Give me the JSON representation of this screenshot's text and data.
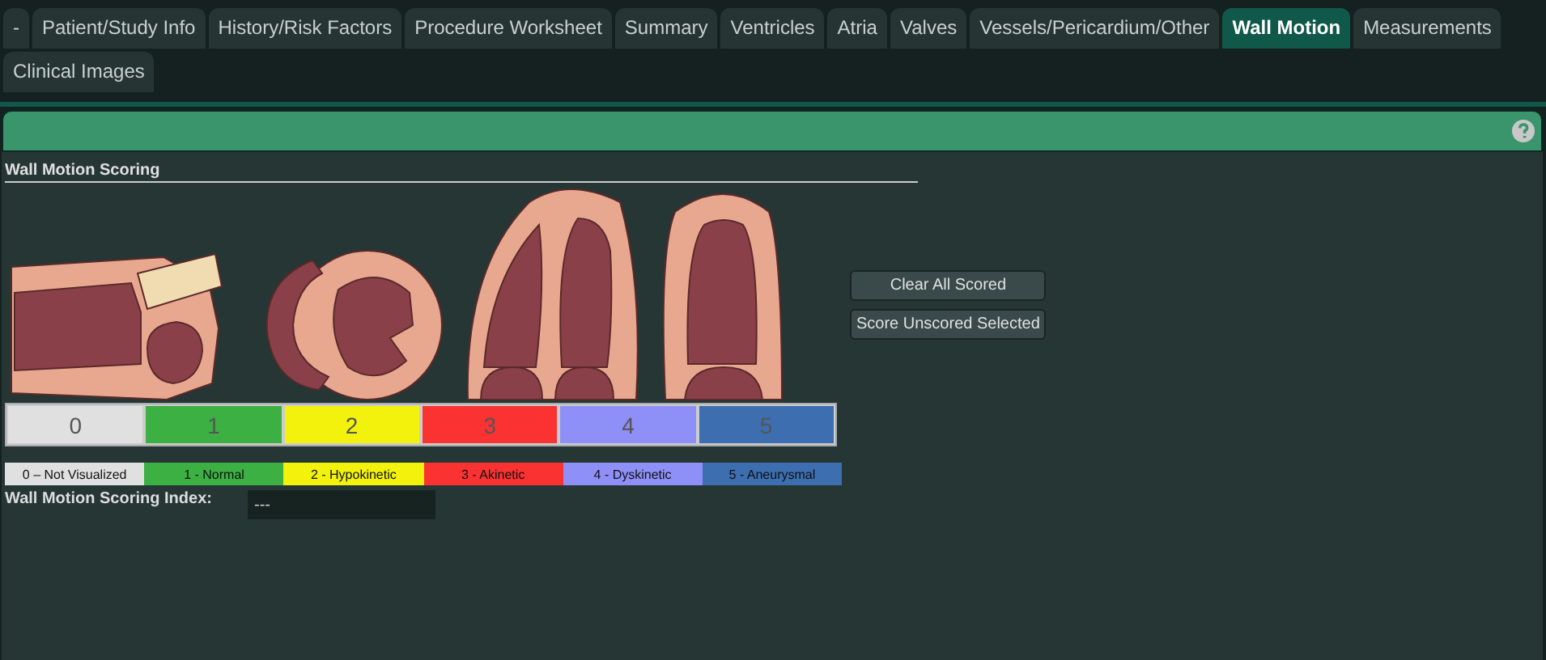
{
  "tabs": [
    {
      "label": "-",
      "selected": false
    },
    {
      "label": "Patient/Study Info",
      "selected": false
    },
    {
      "label": "History/Risk Factors",
      "selected": false
    },
    {
      "label": "Procedure Worksheet",
      "selected": false
    },
    {
      "label": "Summary",
      "selected": false
    },
    {
      "label": "Ventricles",
      "selected": false
    },
    {
      "label": "Atria",
      "selected": false
    },
    {
      "label": "Valves",
      "selected": false
    },
    {
      "label": "Vessels/Pericardium/Other",
      "selected": false
    },
    {
      "label": "Wall Motion",
      "selected": true
    },
    {
      "label": "Measurements",
      "selected": false
    },
    {
      "label": "Clinical Images",
      "selected": false
    }
  ],
  "section_title": "Wall Motion Scoring",
  "scores": [
    {
      "label": "0",
      "color": "#e0e0e0"
    },
    {
      "label": "1",
      "color": "#3cb043"
    },
    {
      "label": "2",
      "color": "#f2f20c"
    },
    {
      "label": "3",
      "color": "#fa3232"
    },
    {
      "label": "4",
      "color": "#8f8ff8"
    },
    {
      "label": "5",
      "color": "#3c6eb0"
    }
  ],
  "legend": [
    {
      "label": "0 – Not Visualized",
      "color": "#e0e0e0"
    },
    {
      "label": "1 - Normal",
      "color": "#3cb043"
    },
    {
      "label": "2 - Hypokinetic",
      "color": "#f2f20c"
    },
    {
      "label": "3 - Akinetic",
      "color": "#fa3232"
    },
    {
      "label": "4 - Dyskinetic",
      "color": "#8f8ff8"
    },
    {
      "label": "5 - Aneurysmal",
      "color": "#3c6eb0"
    }
  ],
  "buttons": [
    "Clear All Scored",
    "Score Unscored Selected"
  ],
  "index": {
    "label": "Wall Motion Scoring Index:",
    "value": "---"
  }
}
